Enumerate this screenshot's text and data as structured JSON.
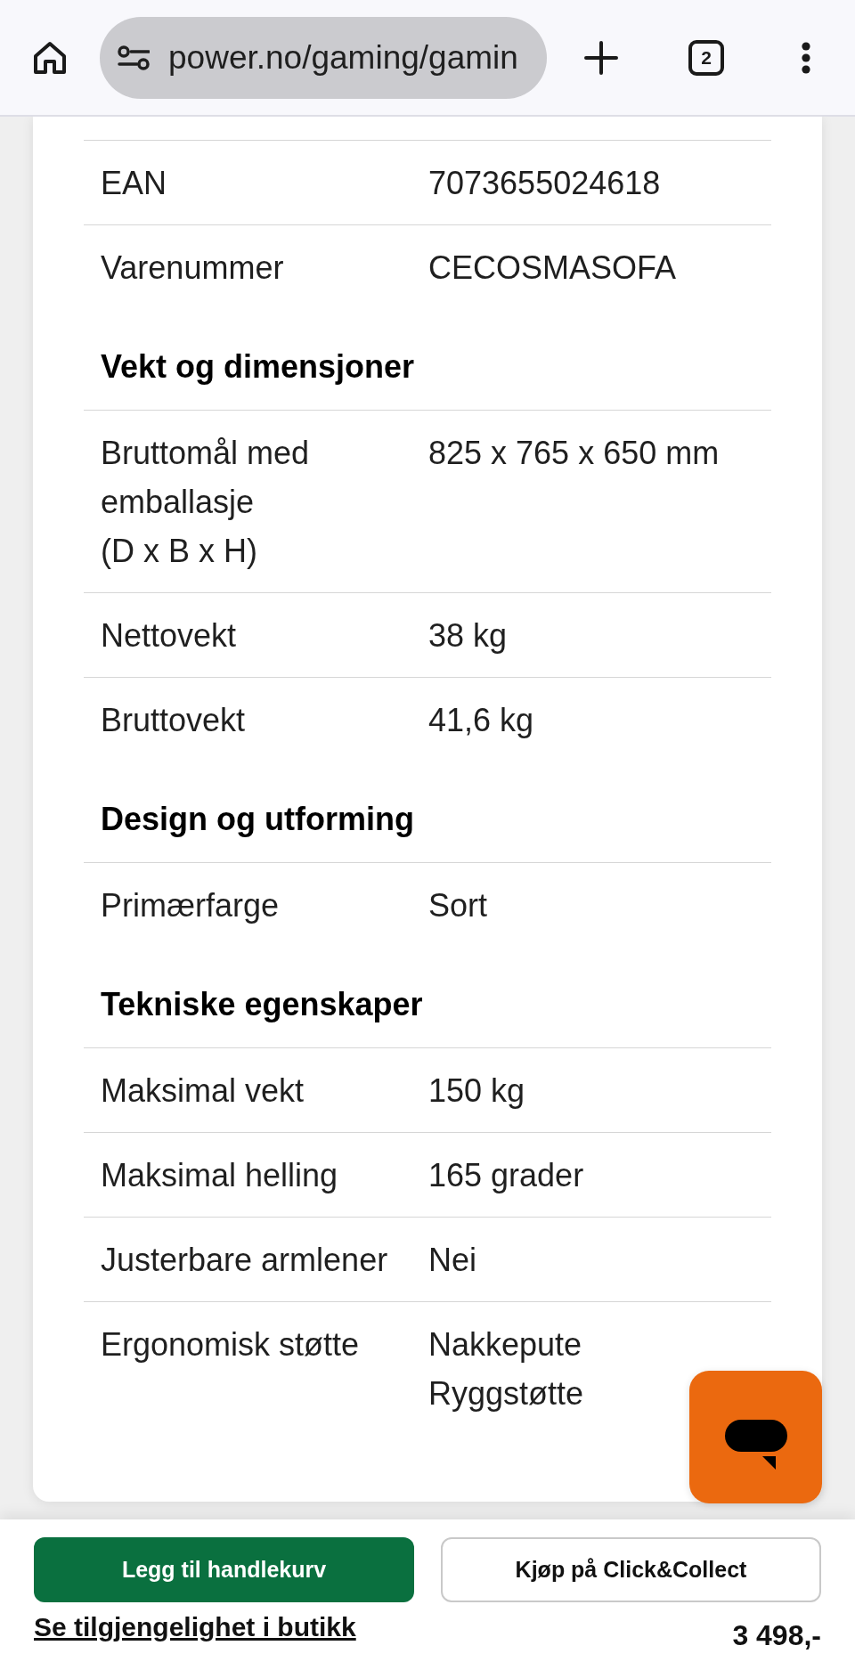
{
  "browser": {
    "url": "power.no/gaming/gamin",
    "tab_count": "2"
  },
  "spec_groups": [
    {
      "rows": [
        {
          "label": "EAN",
          "values": [
            "7073655024618"
          ]
        },
        {
          "label": "Varenummer",
          "values": [
            "CECOSMASOFA"
          ]
        }
      ]
    },
    {
      "title": "Vekt og dimensjoner",
      "rows": [
        {
          "label": "Bruttomål med emballasje (D x B x H)",
          "values": [
            "825 x 765 x 650 mm"
          ]
        },
        {
          "label": "Nettovekt",
          "values": [
            "38 kg"
          ]
        },
        {
          "label": "Bruttovekt",
          "values": [
            "41,6 kg"
          ]
        }
      ]
    },
    {
      "title": "Design og utforming",
      "rows": [
        {
          "label": "Primærfarge",
          "values": [
            "Sort"
          ]
        }
      ]
    },
    {
      "title": "Tekniske egenskaper",
      "rows": [
        {
          "label": "Maksimal vekt",
          "values": [
            "150 kg"
          ]
        },
        {
          "label": "Maksimal helling",
          "values": [
            "165 grader"
          ]
        },
        {
          "label": "Justerbare armlener",
          "values": [
            "Nei"
          ]
        },
        {
          "label": "Ergonomisk støtte",
          "values": [
            "Nakkepute",
            "Ryggstøtte"
          ]
        }
      ]
    }
  ],
  "purchase_bar": {
    "buttons": [
      {
        "kind": "primary",
        "label": "Legg til handlekurv"
      },
      {
        "kind": "outline",
        "label": "Kjøp på Click&Collect"
      }
    ],
    "store_link": "Se tilgjengelighet i butikk",
    "price": "3 498,-"
  }
}
